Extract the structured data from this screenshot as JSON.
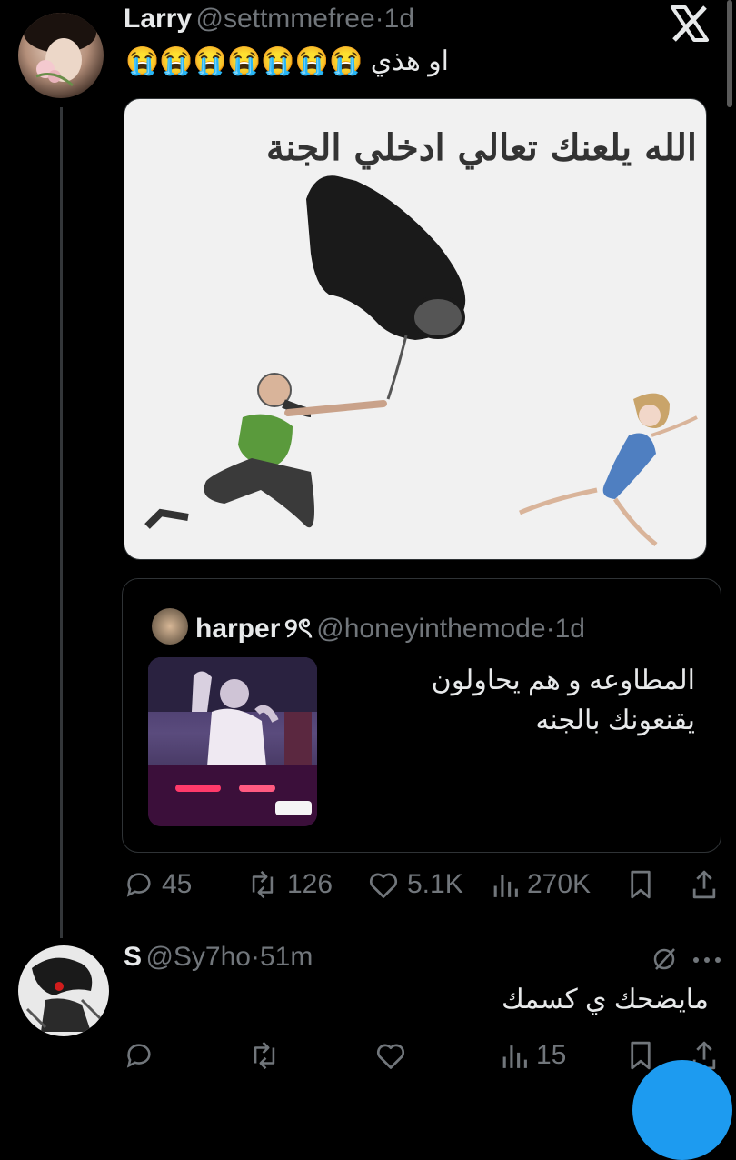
{
  "tweet": {
    "display_name": "Larry",
    "handle": "@settmmefree",
    "separator": "·",
    "time": "1d",
    "text": "او هذي 😭😭😭😭😭😭😭",
    "image_caption": "الله يلعنك تعالي ادخلي الجنة",
    "quoted": {
      "display_name": "harper",
      "name_suffix": "୨ৎ",
      "handle": "@honeyinthemode",
      "separator": "·",
      "time": "1d",
      "text_line1": "المطاوعه و هم يحاولون",
      "text_line2": "يقنعونك بالجنه"
    },
    "actions": {
      "replies": "45",
      "reposts": "126",
      "likes": "5.1K",
      "views": "270K"
    }
  },
  "reply": {
    "display_name": "S",
    "handle": "@Sy7ho",
    "separator": "·",
    "time": "51m",
    "text": "مايضحك ي كسمك",
    "actions": {
      "views": "15"
    }
  },
  "icons": {
    "close": "x-logo-icon",
    "reply": "reply-icon",
    "repost": "repost-icon",
    "like": "heart-icon",
    "views": "views-icon",
    "bookmark": "bookmark-icon",
    "share": "share-icon",
    "grok": "slash-circle-icon",
    "more": "more-icon"
  },
  "colors": {
    "background": "#000000",
    "text": "#e7e9ea",
    "muted": "#71767b",
    "accent": "#1d9bf0",
    "border": "#2f3336"
  }
}
